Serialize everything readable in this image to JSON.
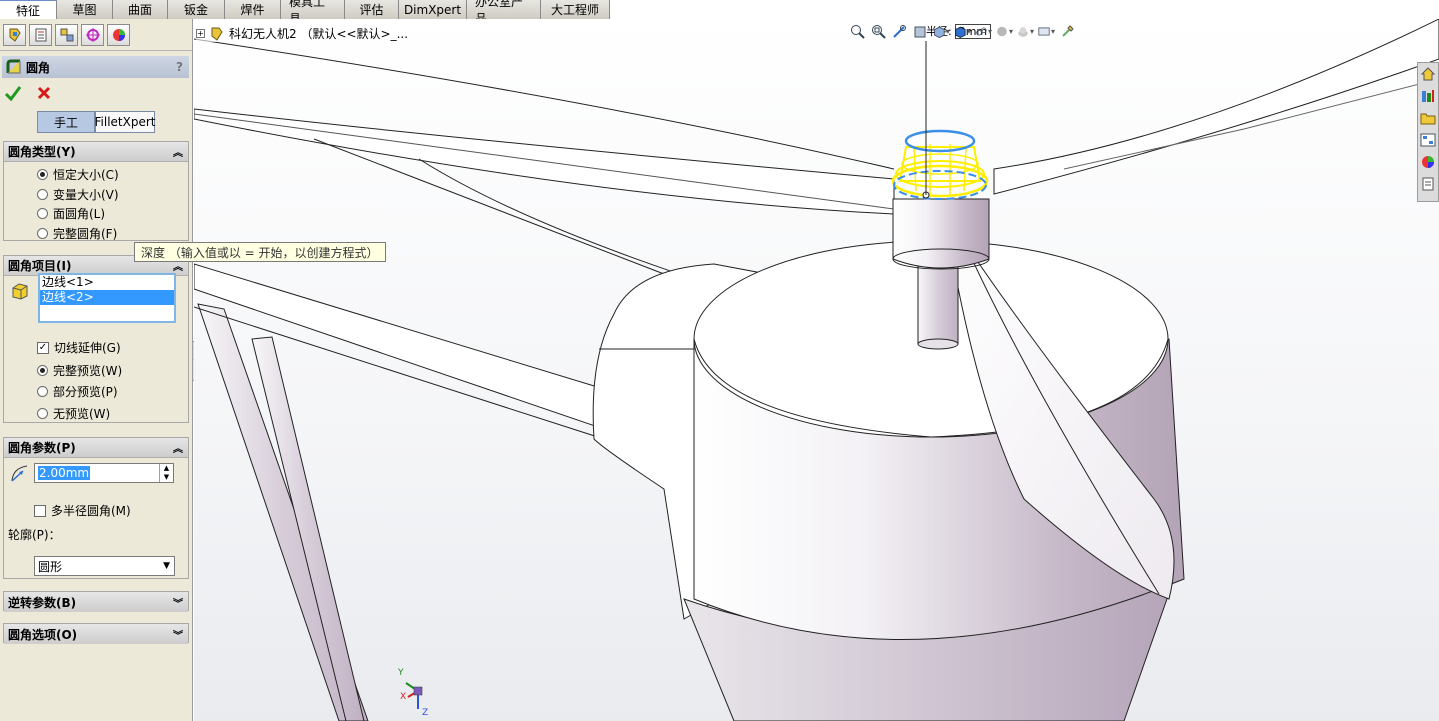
{
  "tabs": [
    "特征",
    "草图",
    "曲面",
    "钣金",
    "焊件",
    "模具工具",
    "评估",
    "DimXpert",
    "办公室产品",
    "大工程师"
  ],
  "property_manager": {
    "title": "圆角",
    "help": "?",
    "mode_buttons": [
      "手工",
      "FilletXpert"
    ],
    "fillet_type": {
      "header": "圆角类型(Y)",
      "options": [
        "恒定大小(C)",
        "变量大小(V)",
        "面圆角(L)",
        "完整圆角(F)"
      ],
      "selected": "恒定大小(C)"
    },
    "fillet_items": {
      "header": "圆角项目(I)",
      "list": [
        "边线<1>",
        "边线<2>"
      ],
      "tangent_propagation": "切线延伸(G)",
      "previews": [
        "完整预览(W)",
        "部分预览(P)",
        "无预览(W)"
      ],
      "selected_preview": "完整预览(W)"
    },
    "fillet_params": {
      "header": "圆角参数(P)",
      "radius": "2.00mm",
      "multi_radius": "多半径圆角(M)",
      "profile_label": "轮廓(P)：",
      "profile_value": "圆形"
    },
    "setback_header": "逆转参数(B)",
    "options_header": "圆角选项(O)"
  },
  "tooltip": "深度 （输入值或以 = 开始，以创建方程式）",
  "viewport": {
    "doc_title": "科幻无人机2 （默认<<默认>_...",
    "radius_label": "半径:",
    "radius_value": "2mm"
  },
  "triad": {
    "y": "Y",
    "x": "X",
    "z": "Z"
  },
  "colors": {
    "accent": "#3399ff",
    "preview_highlight": "#ffee00",
    "selected_edge": "#3a8ee8",
    "model_shade": "#c9bccb"
  },
  "icons": {
    "ok": "check-icon",
    "cancel": "cross-icon",
    "radius": "radius-icon",
    "edge_selection": "edge-selection-icon"
  }
}
